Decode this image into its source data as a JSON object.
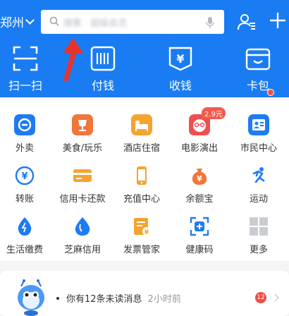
{
  "header": {
    "city": "郑州",
    "search_placeholder": "搜索 · 超级会员"
  },
  "main_actions": [
    {
      "label": "扫一扫",
      "icon": "scan-icon"
    },
    {
      "label": "付钱",
      "icon": "barcode-pay-icon"
    },
    {
      "label": "收钱",
      "icon": "yuan-receive-icon"
    },
    {
      "label": "卡包",
      "icon": "card-pack-icon"
    }
  ],
  "services": [
    {
      "label": "外卖",
      "icon": "takeout-icon",
      "color": "#1f7bf2"
    },
    {
      "label": "美食/玩乐",
      "icon": "food-icon",
      "color": "#f0763a"
    },
    {
      "label": "酒店住宿",
      "icon": "hotel-icon",
      "color": "#f5a331"
    },
    {
      "label": "电影演出",
      "icon": "movie-icon",
      "color": "#ef4f4f"
    },
    {
      "label": "市民中心",
      "icon": "citizen-icon",
      "color": "#1f7bf2"
    },
    {
      "label": "转账",
      "icon": "transfer-icon",
      "color": "#1f7bf2"
    },
    {
      "label": "信用卡还款",
      "icon": "credit-card-icon",
      "color": "#f5a331"
    },
    {
      "label": "充值中心",
      "icon": "phone-recharge-icon",
      "color": "#f5a331"
    },
    {
      "label": "余额宝",
      "icon": "yuebao-icon",
      "color": "#f0763a"
    },
    {
      "label": "运动",
      "icon": "sport-icon",
      "color": "#1f7bf2"
    },
    {
      "label": "生活缴费",
      "icon": "utility-icon",
      "color": "#1f7bf2"
    },
    {
      "label": "芝麻信用",
      "icon": "sesame-icon",
      "color": "#1f7bf2"
    },
    {
      "label": "发票管家",
      "icon": "invoice-icon",
      "color": "#f5a331"
    },
    {
      "label": "健康码",
      "icon": "health-code-icon",
      "color": "#1f7bf2"
    },
    {
      "label": "更多",
      "icon": "more-grid-icon",
      "color": "#c9cdd3"
    }
  ],
  "movie_badge": "2.9元",
  "message": {
    "text": "你有12条未读消息",
    "time": "2小时前",
    "count": "12"
  },
  "colors": {
    "brand_blue": "#1a7cf3",
    "annotation_red": "#e8322b"
  }
}
